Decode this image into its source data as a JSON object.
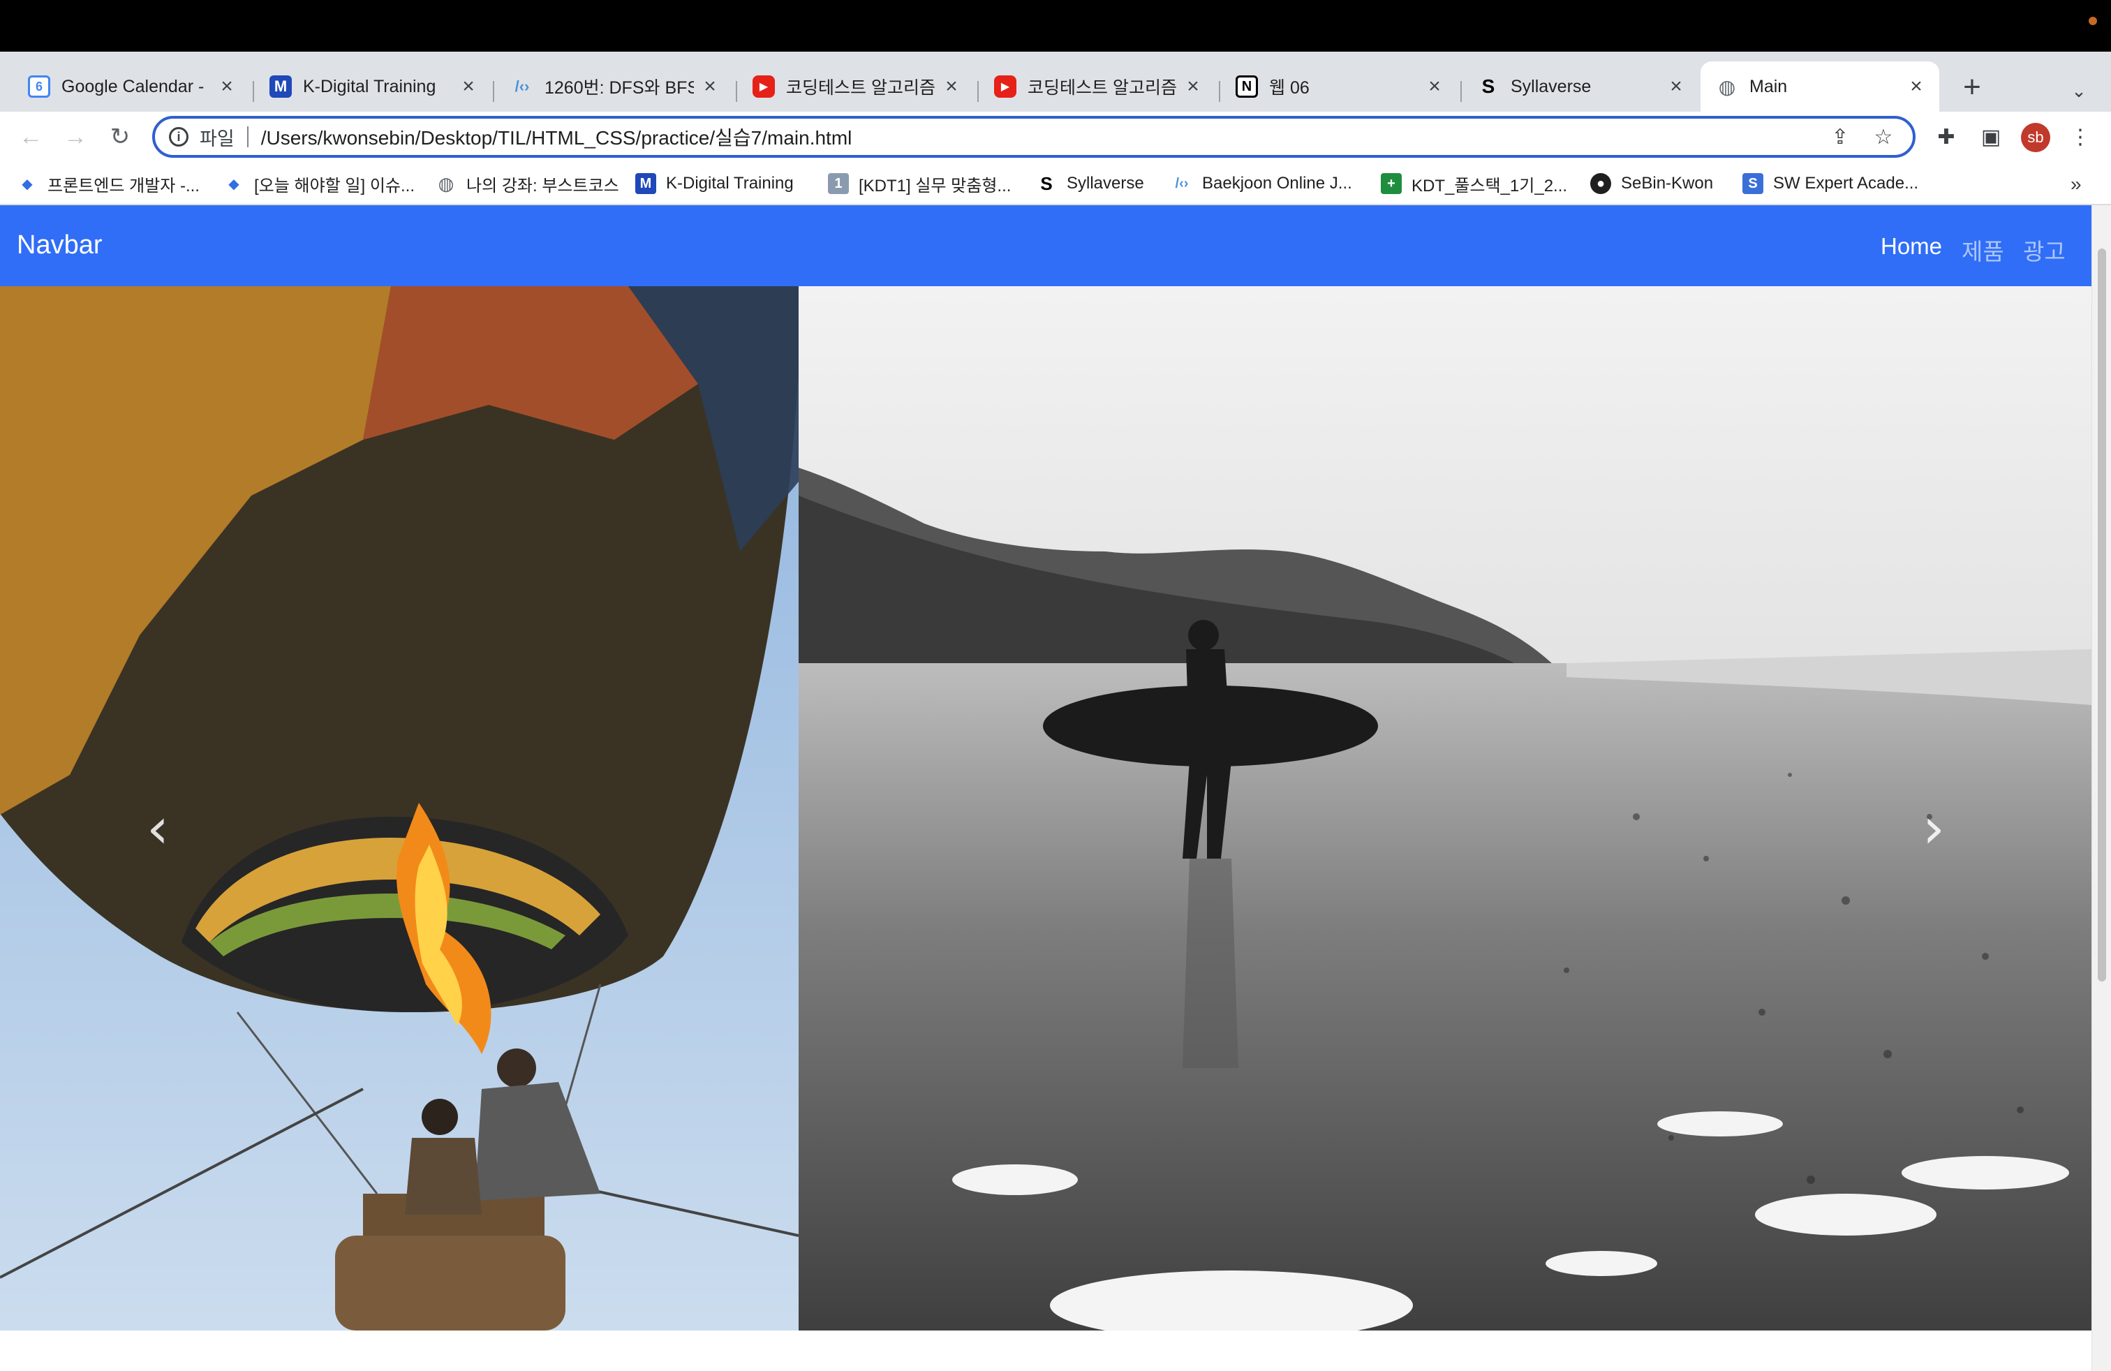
{
  "browser": {
    "tabs": [
      {
        "title": "Google Calendar -",
        "icon": "google-calendar-icon"
      },
      {
        "title": "K-Digital Training",
        "icon": "k-digital-icon"
      },
      {
        "title": "1260번: DFS와 BFS",
        "icon": "code-icon"
      },
      {
        "title": "코딩테스트 알고리즘 -",
        "icon": "youtube-icon"
      },
      {
        "title": "코딩테스트 알고리즘 -",
        "icon": "youtube-icon"
      },
      {
        "title": "웹 06",
        "icon": "notion-icon"
      },
      {
        "title": "Syllaverse",
        "icon": "syllaverse-icon"
      },
      {
        "title": "Main",
        "icon": "globe-icon"
      }
    ],
    "omnibox": {
      "scheme_label": "파일",
      "url": "/Users/kwonsebin/Desktop/TIL/HTML_CSS/practice/실습7/main.html"
    },
    "profile_initials": "sb",
    "bookmarks": [
      {
        "label": "프론트엔드 개발자 -...",
        "icon": "diamond-icon"
      },
      {
        "label": "[오늘 해야할 일] 이슈...",
        "icon": "diamond-icon"
      },
      {
        "label": "나의 강좌: 부스트코스",
        "icon": "globe-icon"
      },
      {
        "label": "K-Digital Training",
        "icon": "k-digital-icon"
      },
      {
        "label": "[KDT1] 실무 맞춤형...",
        "icon": "number-one-icon"
      },
      {
        "label": "Syllaverse",
        "icon": "syllaverse-icon"
      },
      {
        "label": "Baekjoon Online J...",
        "icon": "code-icon"
      },
      {
        "label": "KDT_풀스택_1기_2...",
        "icon": "sheets-icon"
      },
      {
        "label": "SeBin-Kwon",
        "icon": "github-icon"
      },
      {
        "label": "SW Expert Acade...",
        "icon": "swea-icon"
      }
    ],
    "bookmarks_overflow": "»"
  },
  "page": {
    "navbar": {
      "brand": "Navbar",
      "links": [
        {
          "label": "Home",
          "active": true
        },
        {
          "label": "제품",
          "active": false
        },
        {
          "label": "광고",
          "active": false
        }
      ],
      "color": "#306ef7"
    },
    "carousel": {
      "prev_glyph": "‹",
      "next_glyph": "›",
      "indicator_count": 3,
      "active_indicator": 1,
      "slides": [
        {
          "subject": "hot-air-balloon-photo"
        },
        {
          "subject": "surfer-on-beach-photo"
        }
      ]
    }
  }
}
